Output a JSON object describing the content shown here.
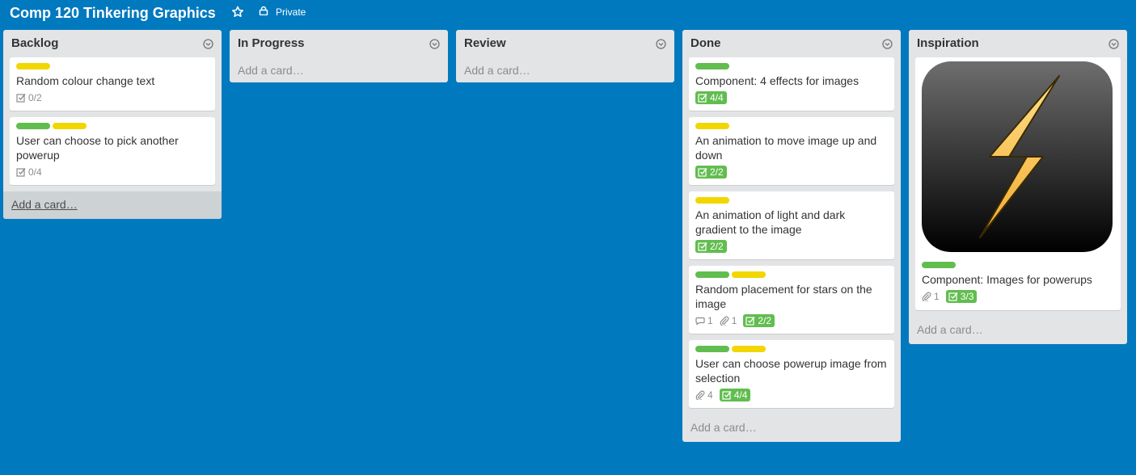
{
  "board": {
    "title": "Comp 120 Tinkering Graphics",
    "visibility": "Private"
  },
  "colors": {
    "background": "#0079bf",
    "label_green": "#61bd4f",
    "label_yellow": "#f2d600"
  },
  "lists": [
    {
      "title": "Backlog",
      "add_card": "Add a card…",
      "cards": [
        {
          "labels": [
            "yellow"
          ],
          "title": "Random colour change text",
          "checklist": "0/2"
        },
        {
          "labels": [
            "green",
            "yellow"
          ],
          "title": "User can choose to pick another powerup",
          "checklist": "0/4"
        }
      ]
    },
    {
      "title": "In Progress",
      "add_card": "Add a card…",
      "cards": []
    },
    {
      "title": "Review",
      "add_card": "Add a card…",
      "cards": []
    },
    {
      "title": "Done",
      "add_card": "Add a card…",
      "cards": [
        {
          "labels": [
            "green"
          ],
          "title": "Component: 4 effects for images",
          "checklist": "4/4"
        },
        {
          "labels": [
            "yellow"
          ],
          "title": "An animation to move image up and down",
          "checklist": "2/2"
        },
        {
          "labels": [
            "yellow"
          ],
          "title": "An animation of light and dark gradient to the image",
          "checklist": "2/2"
        },
        {
          "labels": [
            "green",
            "yellow"
          ],
          "title": "Random placement for stars on the image",
          "comments": "1",
          "attachments": "1",
          "checklist": "2/2"
        },
        {
          "labels": [
            "green",
            "yellow"
          ],
          "title": "User can choose powerup image from selection",
          "attachments": "4",
          "checklist": "4/4"
        }
      ]
    },
    {
      "title": "Inspiration",
      "add_card": "Add a card…",
      "cards": [
        {
          "labels": [
            "green"
          ],
          "title": "Component: Images for powerups",
          "attachments": "1",
          "checklist": "3/3",
          "cover": "lightning-bolt-icon"
        }
      ]
    }
  ]
}
